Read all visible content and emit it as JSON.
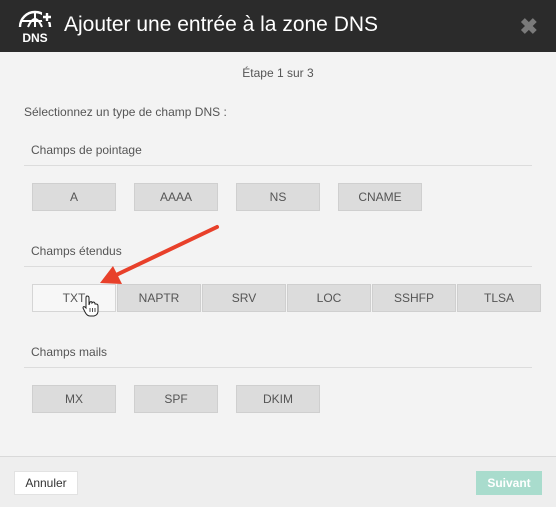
{
  "dialog": {
    "title": "Ajouter une entrée à la zone DNS",
    "logo_label": "DNS",
    "close_label": "✖",
    "step": "Étape 1 sur 3",
    "prompt": "Sélectionnez un type de champ DNS :"
  },
  "sections": {
    "pointage": {
      "title": "Champs de pointage",
      "items": [
        "A",
        "AAAA",
        "NS",
        "CNAME"
      ]
    },
    "etendus": {
      "title": "Champs étendus",
      "items": [
        "TXT",
        "NAPTR",
        "SRV",
        "LOC",
        "SSHFP",
        "TLSA"
      ]
    },
    "mails": {
      "title": "Champs mails",
      "items": [
        "MX",
        "SPF",
        "DKIM"
      ]
    }
  },
  "footer": {
    "cancel_label": "Annuler",
    "next_label": "Suivant"
  },
  "colors": {
    "header": "#2b2b2b",
    "accent": "#a9dccd",
    "arrow": "#e8402a"
  }
}
